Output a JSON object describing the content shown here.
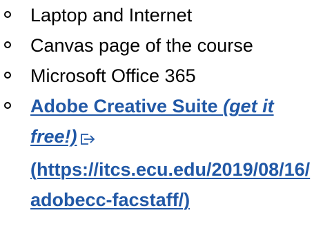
{
  "list": {
    "items": [
      {
        "label": "Laptop and Internet"
      },
      {
        "label": "Canvas page of the course"
      },
      {
        "label": "Microsoft Office 365"
      }
    ],
    "link_item": {
      "label_main": "Adobe Creative Suite ",
      "label_italic_1": "(get it",
      "label_italic_2": "free!)",
      "url_line_1": "(https://itcs.ecu.edu/2019/08/16/",
      "url_line_2": "adobecc-facstaff/)"
    }
  },
  "icons": {
    "bullet": "hollow-circle-bullet",
    "external": "external-link-icon"
  },
  "colors": {
    "text": "#000000",
    "link": "#2158a6",
    "background": "#ffffff"
  }
}
